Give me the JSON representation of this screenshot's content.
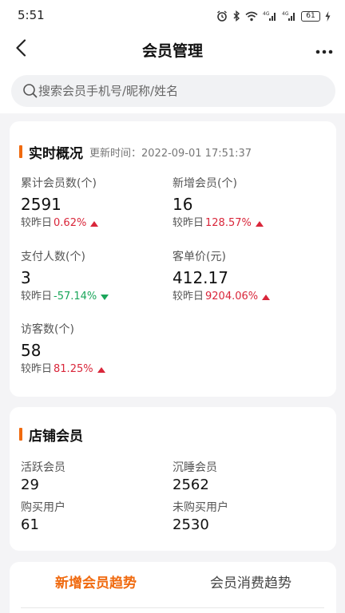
{
  "status_bar": {
    "time": "5:51",
    "battery": "61",
    "icons": [
      "alarm-icon",
      "bluetooth-icon",
      "wifi-icon",
      "signal-4g-icon",
      "signal-4g-icon",
      "battery-icon",
      "charging-icon"
    ]
  },
  "nav": {
    "title": "会员管理",
    "back_icon": "chevron-left-icon",
    "more_icon": "more-dots-icon"
  },
  "search": {
    "placeholder": "搜索会员手机号/昵称/姓名"
  },
  "overview": {
    "title": "实时概况",
    "update_time": "更新时间：2022-09-01 17:51:37",
    "metrics": [
      {
        "label": "累计会员数(个)",
        "value": "2591",
        "compare_label": "较昨日",
        "change": "0.62%",
        "direction": "up"
      },
      {
        "label": "新增会员(个)",
        "value": "16",
        "compare_label": "较昨日",
        "change": "128.57%",
        "direction": "up"
      },
      {
        "label": "支付人数(个)",
        "value": "3",
        "compare_label": "较昨日",
        "change": "-57.14%",
        "direction": "down"
      },
      {
        "label": "客单价(元)",
        "value": "412.17",
        "compare_label": "较昨日",
        "change": "9204.06%",
        "direction": "up"
      },
      {
        "label": "访客数(个)",
        "value": "58",
        "compare_label": "较昨日",
        "change": "81.25%",
        "direction": "up"
      }
    ]
  },
  "store_members": {
    "title": "店铺会员",
    "items": [
      {
        "label": "活跃会员",
        "value": "29"
      },
      {
        "label": "沉睡会员",
        "value": "2562"
      },
      {
        "label": "购买用户",
        "value": "61"
      },
      {
        "label": "未购买用户",
        "value": "2530"
      }
    ]
  },
  "tabs": [
    {
      "label": "新增会员趋势",
      "active": true
    },
    {
      "label": "会员消费趋势",
      "active": false
    }
  ],
  "colors": {
    "accent": "#f06a0f",
    "up": "#d9263a",
    "down": "#1aa65a"
  }
}
